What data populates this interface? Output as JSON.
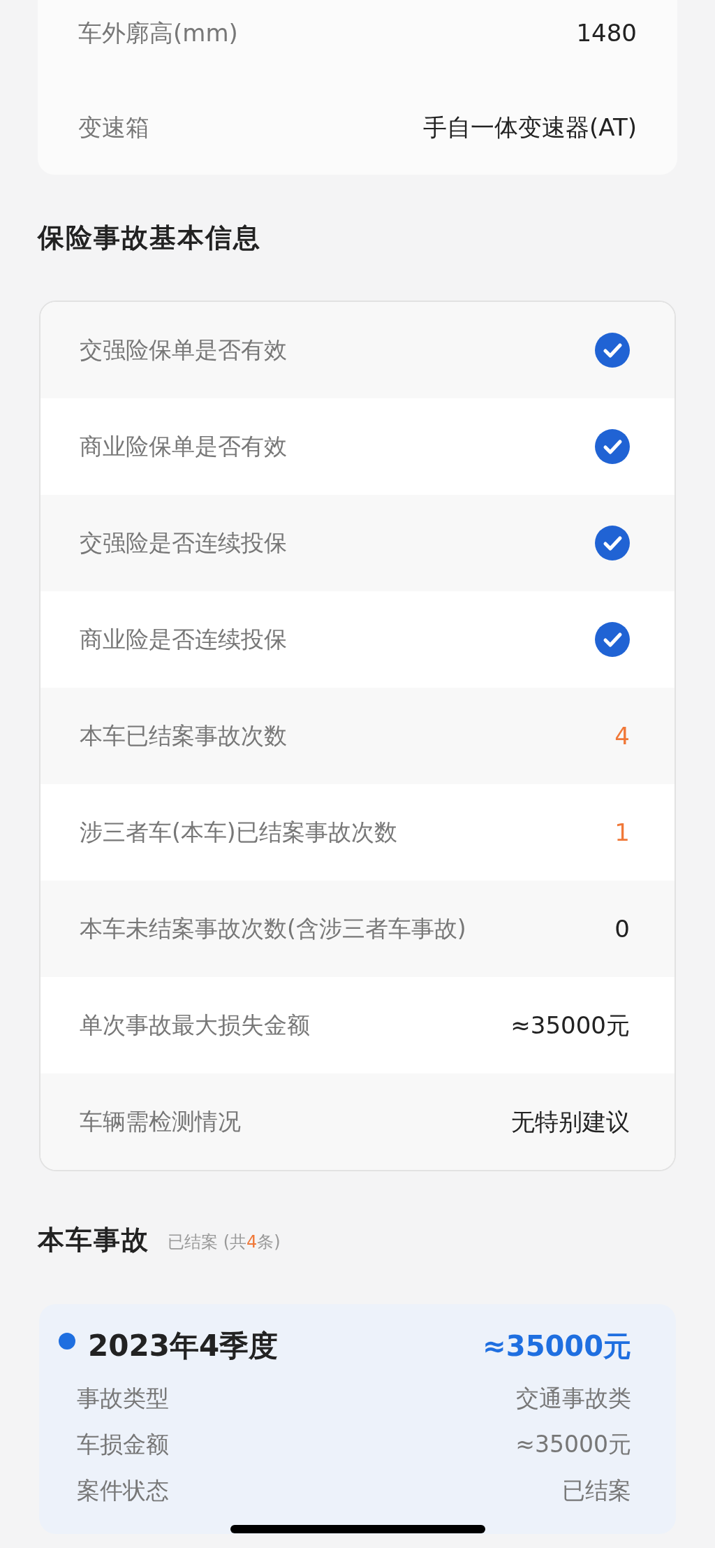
{
  "spec_card": {
    "rows": [
      {
        "label": "车外廓高(mm)",
        "value": "1480"
      },
      {
        "label": "变速箱",
        "value": "手自一体变速器(AT)"
      }
    ]
  },
  "insurance": {
    "title": "保险事故基本信息",
    "rows": [
      {
        "kind": "check",
        "label": "交强险保单是否有效",
        "checked": true
      },
      {
        "kind": "check",
        "label": "商业险保单是否有效",
        "checked": true
      },
      {
        "kind": "check",
        "label": "交强险是否连续投保",
        "checked": true
      },
      {
        "kind": "check",
        "label": "商业险是否连续投保",
        "checked": true
      },
      {
        "kind": "text",
        "label": "本车已结案事故次数",
        "value": "4",
        "color": "#f07838"
      },
      {
        "kind": "text",
        "label": "涉三者车(本车)已结案事故次数",
        "value": "1",
        "color": "#f07838"
      },
      {
        "kind": "text",
        "label": "本车未结案事故次数(含涉三者车事故)",
        "value": "0",
        "color": "#222222"
      },
      {
        "kind": "text",
        "label": "单次事故最大损失金额",
        "value": "≈35000元",
        "color": "#222222"
      },
      {
        "kind": "text",
        "label": "车辆需检测情况",
        "value": "无特别建议",
        "color": "#222222"
      }
    ]
  },
  "accidents": {
    "title": "本车事故",
    "status": "已结案",
    "count_prefix": "(共",
    "count": "4",
    "count_suffix": "条)",
    "items": [
      {
        "color": "#1f6fe0",
        "period": "2023年4季度",
        "amount": "≈35000元",
        "details": [
          {
            "label": "事故类型",
            "value": "交通事故类"
          },
          {
            "label": "车损金额",
            "value": "≈35000元"
          },
          {
            "label": "案件状态",
            "value": "已结案"
          }
        ]
      }
    ]
  }
}
